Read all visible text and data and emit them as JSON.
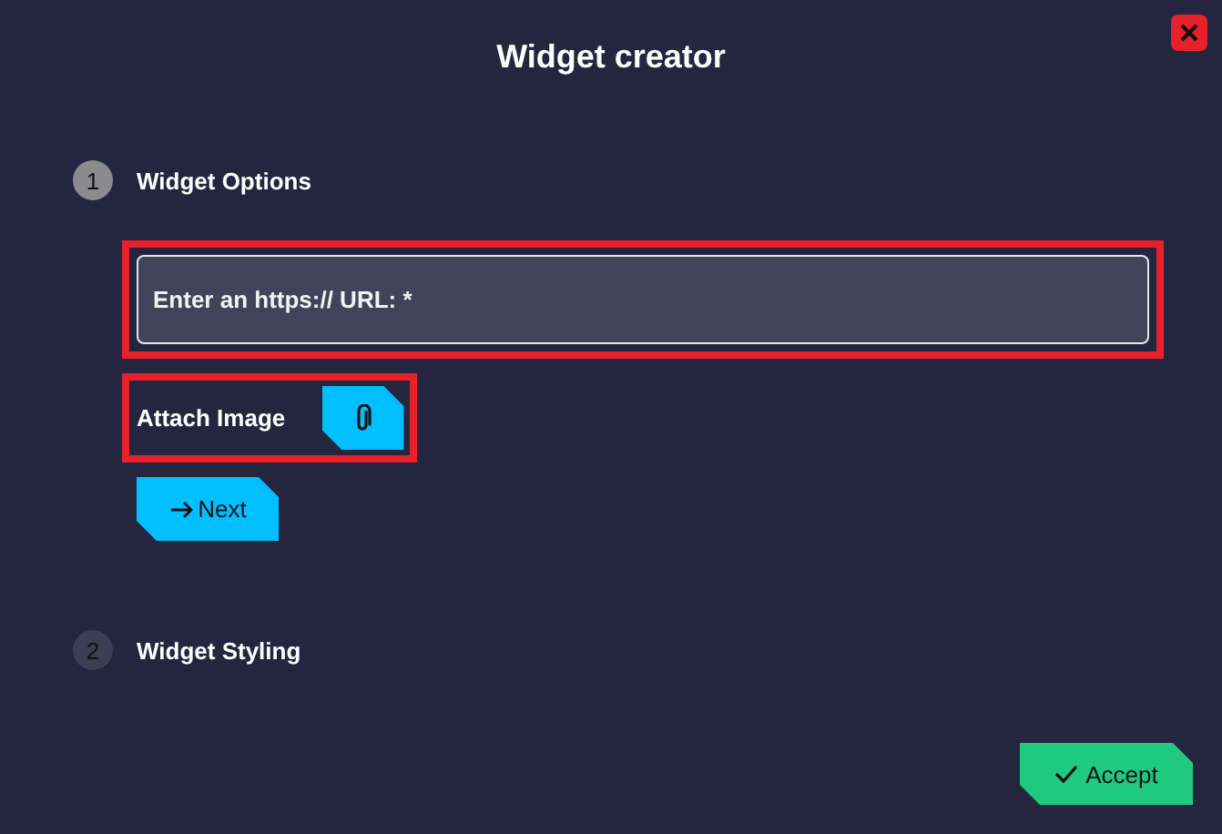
{
  "window": {
    "title": "Widget creator"
  },
  "steps": [
    {
      "number": "1",
      "label": "Widget Options",
      "active": true,
      "url_field": {
        "placeholder": "Enter an https:// URL: *",
        "highlighted": true
      },
      "attach": {
        "label": "Attach Image",
        "highlighted": true
      },
      "next_button": {
        "label": "Next"
      }
    },
    {
      "number": "2",
      "label": "Widget Styling",
      "active": false
    }
  ],
  "accept_button": {
    "label": "Accept"
  }
}
